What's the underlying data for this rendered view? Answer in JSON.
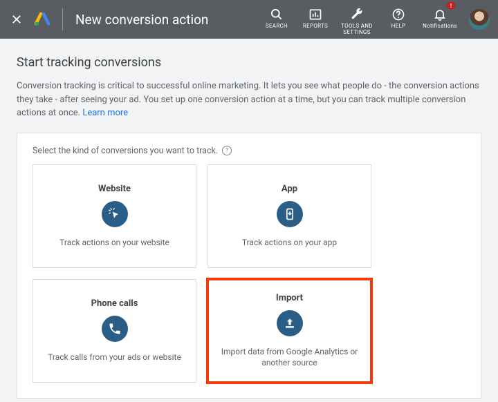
{
  "header": {
    "title": "New conversion action",
    "nav": {
      "search": "SEARCH",
      "reports": "REPORTS",
      "tools": "TOOLS AND SETTINGS",
      "help": "HELP",
      "notifications": "Notifications",
      "badge": "!"
    }
  },
  "page": {
    "heading": "Start tracking conversions",
    "description": "Conversion tracking is critical to successful online marketing. It lets you see what people do - the conversion actions they take - after seeing your ad. You set up one conversion action at a time, but you can track multiple conversion actions at once.  ",
    "learn_more": "Learn more"
  },
  "card": {
    "prompt": "Select the kind of conversions you want to track.",
    "options": [
      {
        "title": "Website",
        "desc": "Track actions on your website"
      },
      {
        "title": "App",
        "desc": "Track actions on your app"
      },
      {
        "title": "Phone calls",
        "desc": "Track calls from your ads or website"
      },
      {
        "title": "Import",
        "desc": "Import data from Google Analytics or another source"
      }
    ]
  }
}
